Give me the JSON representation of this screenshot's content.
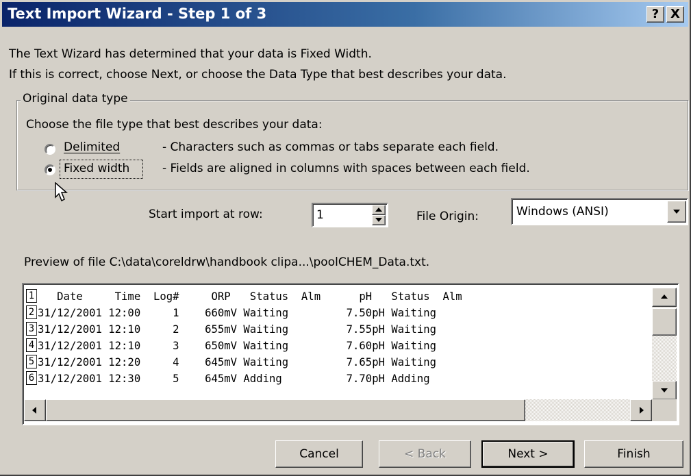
{
  "window": {
    "title": "Text Import Wizard - Step 1 of 3",
    "help_label": "?",
    "close_label": "X"
  },
  "intro": {
    "line1": "The Text Wizard has determined that your data is Fixed Width.",
    "line2": "If this is correct, choose Next, or choose the Data Type that best describes your data."
  },
  "original_data_type": {
    "legend": "Original data type",
    "prompt": "Choose the file type that best describes your data:",
    "options": [
      {
        "label": "Delimited",
        "description": "- Characters such as commas or tabs separate each field.",
        "selected": false
      },
      {
        "label": "Fixed width",
        "description": "- Fields are aligned in columns with spaces between each field.",
        "selected": true
      }
    ]
  },
  "start_import": {
    "label": "Start import at row:",
    "value": "1"
  },
  "file_origin": {
    "label": "File Origin:",
    "value": "Windows (ANSI)"
  },
  "preview": {
    "label": "Preview of file C:\\data\\coreldrw\\handbook clipa...\\poolCHEM_Data.txt.",
    "rows": [
      {
        "num": "1",
        "text": "   Date     Time  Log#     ORP   Status  Alm      pH   Status  Alm"
      },
      {
        "num": "2",
        "text": "31/12/2001 12:00     1    660mV Waiting         7.50pH Waiting"
      },
      {
        "num": "3",
        "text": "31/12/2001 12:10     2    655mV Waiting         7.55pH Waiting"
      },
      {
        "num": "4",
        "text": "31/12/2001 12:10     3    650mV Waiting         7.60pH Waiting"
      },
      {
        "num": "5",
        "text": "31/12/2001 12:20     4    645mV Waiting         7.65pH Waiting"
      },
      {
        "num": "6",
        "text": "31/12/2001 12:30     5    645mV Adding          7.70pH Adding"
      }
    ]
  },
  "buttons": {
    "cancel": "Cancel",
    "back": "< Back",
    "next": "Next >",
    "finish": "Finish"
  },
  "colors": {
    "title_gradient_start": "#0a246a",
    "title_gradient_end": "#a6caf0",
    "face": "#d4d0c8"
  }
}
